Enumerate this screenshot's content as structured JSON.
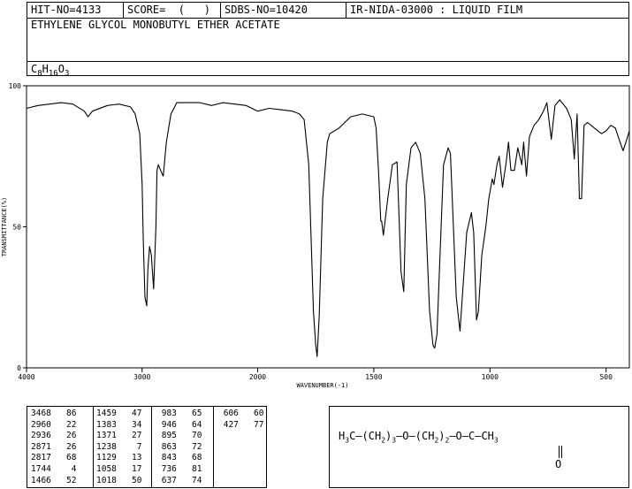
{
  "header": {
    "hit_no": "HIT-NO=4133",
    "score": "SCORE=  (   )",
    "sdbs_no": "SDBS-NO=10420",
    "method": "IR-NIDA-03000 : LIQUID FILM",
    "compound_name": "ETHYLENE GLYCOL MONOBUTYL ETHER ACETATE",
    "formula": {
      "c": "C",
      "c_n": "8",
      "h": "H",
      "h_n": "16",
      "o": "O",
      "o_n": "3"
    }
  },
  "chart_data": {
    "type": "line",
    "xlabel": "WAVENUMBER(-1)",
    "ylabel": "TRANSMITTANCE(%)",
    "xlim": [
      4000,
      400
    ],
    "ylim": [
      0,
      100
    ],
    "x_ticks": [
      "4000",
      "3000",
      "2000",
      "1500",
      "1000",
      "500"
    ],
    "y_ticks": [
      "100",
      "50",
      "0"
    ],
    "series": [
      {
        "x": [
          4000,
          3900,
          3800,
          3700,
          3600,
          3500,
          3468,
          3430,
          3300,
          3200,
          3100,
          3060,
          3020,
          3000,
          2990,
          2975,
          2960,
          2950,
          2935,
          2920,
          2900,
          2880,
          2871,
          2860,
          2840,
          2817,
          2790,
          2750,
          2700,
          2600,
          2500,
          2400,
          2300,
          2200,
          2100,
          2050,
          2000,
          1950,
          1900,
          1850,
          1820,
          1800,
          1780,
          1760,
          1750,
          1744,
          1735,
          1720,
          1700,
          1690,
          1650,
          1600,
          1550,
          1500,
          1490,
          1480,
          1470,
          1466,
          1459,
          1440,
          1420,
          1400,
          1383,
          1371,
          1360,
          1340,
          1320,
          1300,
          1280,
          1260,
          1245,
          1238,
          1228,
          1215,
          1200,
          1180,
          1170,
          1160,
          1145,
          1129,
          1115,
          1100,
          1080,
          1070,
          1058,
          1050,
          1035,
          1018,
          1005,
          990,
          983,
          970,
          960,
          946,
          930,
          920,
          910,
          895,
          880,
          863,
          855,
          843,
          830,
          810,
          790,
          770,
          755,
          736,
          720,
          700,
          670,
          650,
          637,
          625,
          615,
          606,
          595,
          580,
          550,
          520,
          500,
          480,
          460,
          440,
          427,
          415,
          400
        ],
        "y": [
          92,
          93,
          93.5,
          94,
          93.5,
          91,
          89,
          91,
          93,
          93.5,
          92.5,
          90,
          83,
          65,
          45,
          25,
          22,
          35,
          43,
          40,
          28,
          50,
          70,
          72,
          70,
          68,
          80,
          90,
          94,
          94,
          94,
          93,
          94,
          93.5,
          93,
          92,
          91,
          92,
          91.5,
          91,
          90,
          88,
          72,
          20,
          8,
          4,
          18,
          60,
          80,
          83,
          85,
          89,
          90,
          89,
          85,
          70,
          52,
          52,
          47,
          60,
          72,
          73,
          34,
          27,
          65,
          78,
          80,
          76,
          60,
          20,
          8,
          7,
          12,
          40,
          72,
          78,
          76,
          55,
          25,
          13,
          30,
          48,
          55,
          48,
          17,
          20,
          40,
          50,
          60,
          67,
          65,
          72,
          75,
          64,
          73,
          80,
          70,
          70,
          78,
          72,
          80,
          68,
          82,
          86,
          88,
          91,
          94,
          81,
          93,
          95,
          92,
          88,
          74,
          90,
          60,
          60,
          86,
          87,
          85,
          83,
          84,
          86,
          85,
          80,
          77,
          80,
          84
        ]
      }
    ]
  },
  "peak_table": [
    [
      "3468",
      "86",
      "1459",
      "47",
      "983",
      "65",
      "606",
      "60"
    ],
    [
      "2960",
      "22",
      "1383",
      "34",
      "946",
      "64",
      "427",
      "77"
    ],
    [
      "2936",
      "26",
      "1371",
      "27",
      "895",
      "70",
      "",
      ""
    ],
    [
      "2871",
      "26",
      "1238",
      "7",
      "863",
      "72",
      "",
      ""
    ],
    [
      "2817",
      "68",
      "1129",
      "13",
      "843",
      "68",
      "",
      ""
    ],
    [
      "1744",
      "4",
      "1058",
      "17",
      "736",
      "81",
      "",
      ""
    ],
    [
      "1466",
      "52",
      "1018",
      "50",
      "637",
      "74",
      "",
      ""
    ]
  ],
  "structure": {
    "text": "H3C—(CH2)3—O—(CH2)2—O—C—CH3",
    "carbonyl_o": "O"
  }
}
